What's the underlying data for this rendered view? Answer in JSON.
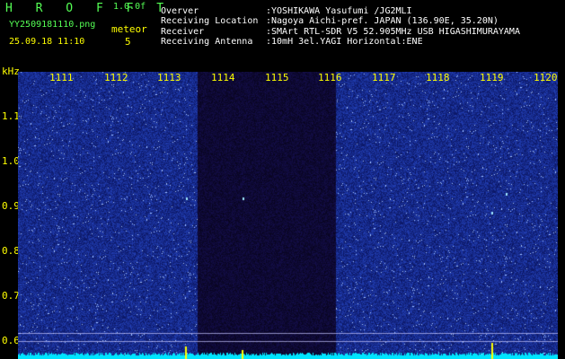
{
  "app": {
    "title": "H R O F F T",
    "version": "1.0.0f"
  },
  "file": {
    "name": "YY2509181110.png",
    "timestamp": "25.09.18 11:10"
  },
  "meteor": {
    "label": "meteor",
    "count": "5"
  },
  "info": [
    {
      "label": "Overver",
      "value": ":YOSHIKAWA Yasufumi /JG2MLI"
    },
    {
      "label": "Receiving Location",
      "value": ":Nagoya Aichi-pref. JAPAN (136.90E, 35.20N)"
    },
    {
      "label": "Receiver",
      "value": ":SMArt RTL-SDR V5 52.905MHz USB HIGASHIMURAYAMA"
    },
    {
      "label": "Receiving Antenna",
      "value": ":10mH 3el.YAGI Horizontal:ENE"
    }
  ],
  "axis": {
    "unit": "kHz",
    "y_ticks": [
      "1.1",
      "1.0",
      "0.9",
      "0.8",
      "0.7",
      "0.6"
    ],
    "x_ticks": [
      "1111",
      "1112",
      "1113",
      "1114",
      "1115",
      "1116",
      "1117",
      "1118",
      "1119",
      "1120"
    ]
  },
  "colors": {
    "label": "#ffff00",
    "title": "#55ff55",
    "spectrum": "#1c2aa8",
    "baseline": "#00e5ff"
  }
}
